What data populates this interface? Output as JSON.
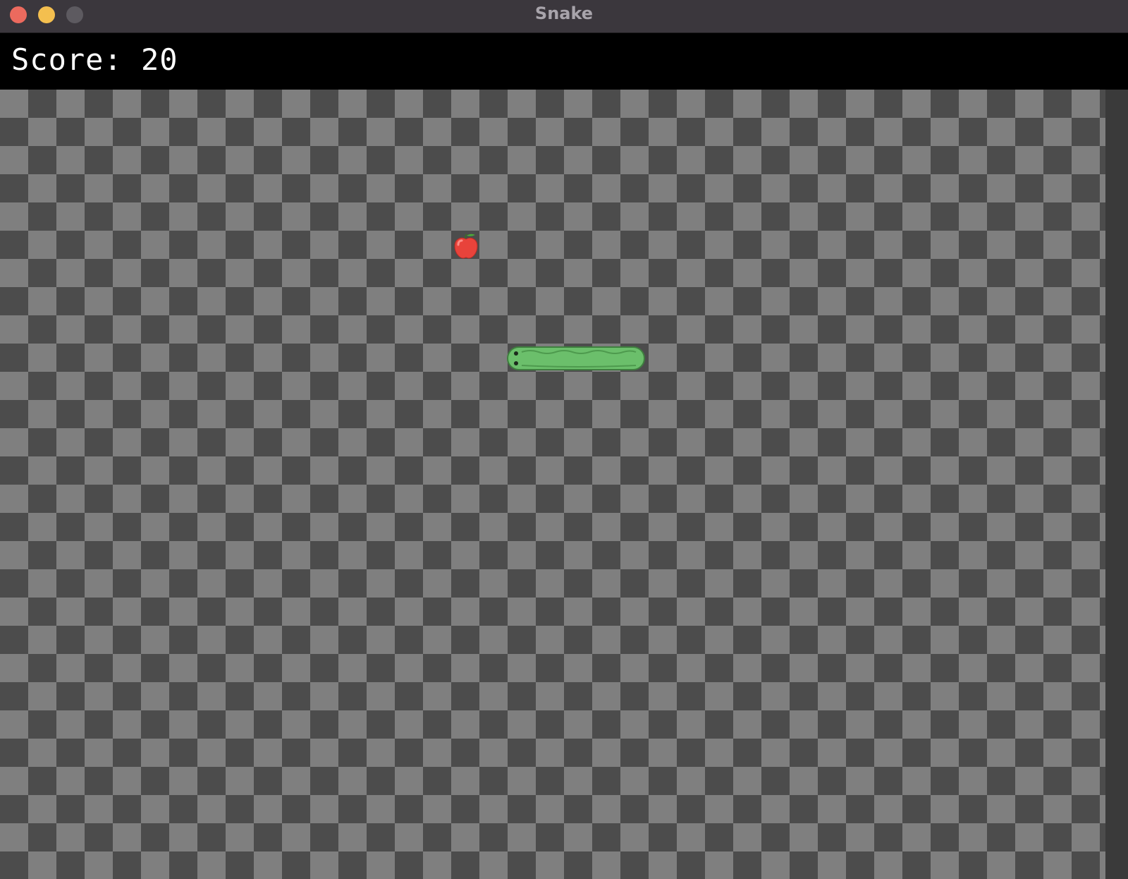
{
  "window": {
    "title": "Snake",
    "controls": {
      "close_color": "#ec6a5e",
      "minimize_color": "#f4bf4f",
      "zoom_color": "#5d5a60"
    }
  },
  "hud": {
    "score_label": "Score: 20"
  },
  "board": {
    "light_tile_color": "#7f7f7f",
    "dark_tile_color": "#4c4c4c"
  },
  "snake": {
    "color": "#6bbf6b",
    "direction": "left",
    "length_cells": 5
  },
  "food": {
    "icon": "apple-icon",
    "color": "#e8433b"
  }
}
